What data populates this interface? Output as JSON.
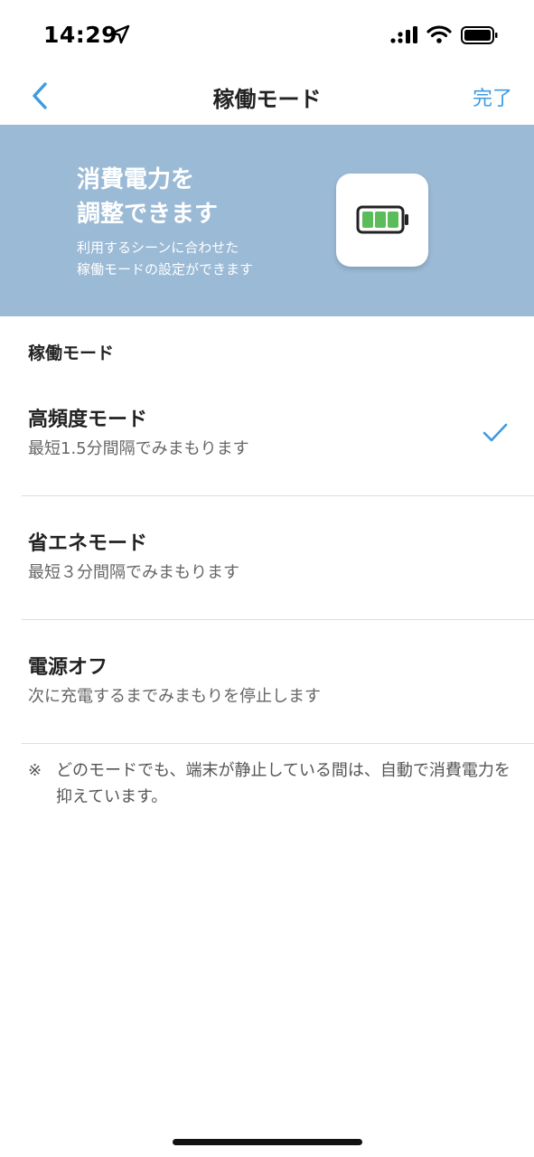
{
  "status_bar": {
    "time": "14:29"
  },
  "nav": {
    "title": "稼働モード",
    "done_label": "完了"
  },
  "banner": {
    "headline": "消費電力を\n調整できます",
    "subtext": "利用するシーンに合わせた\n稼働モードの設定ができます"
  },
  "section_label": "稼働モード",
  "modes": [
    {
      "title": "高頻度モード",
      "description": "最短1.5分間隔でみまもります",
      "selected": true
    },
    {
      "title": "省エネモード",
      "description": "最短３分間隔でみまもります",
      "selected": false
    },
    {
      "title": "電源オフ",
      "description": "次に充電するまでみまもりを停止します",
      "selected": false
    }
  ],
  "note": {
    "mark": "※",
    "text": "どのモードでも、端末が静止している間は、自動で消費電力を抑えています。"
  },
  "colors": {
    "accent": "#3d9be2",
    "banner": "#9bbad6",
    "battery_green": "#5bbd5a"
  }
}
